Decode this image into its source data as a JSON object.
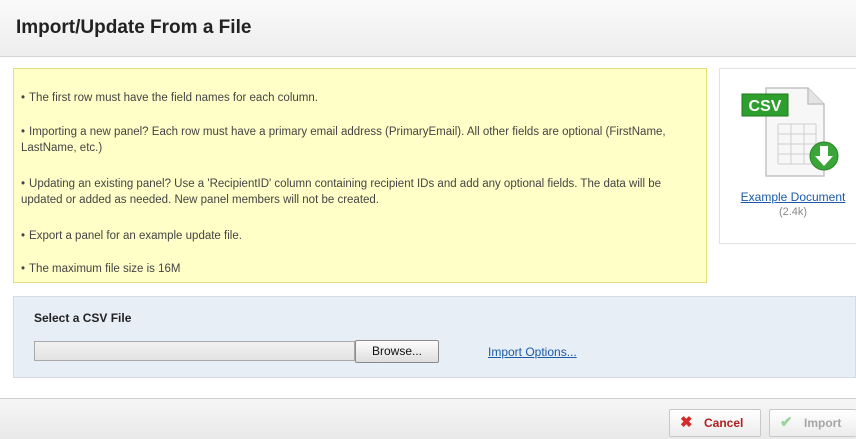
{
  "dialog": {
    "title": "Import/Update From a File"
  },
  "info": {
    "items": [
      "The first row must have the field names for each column.",
      "Importing a new panel? Each row must have a primary email address (PrimaryEmail). All other fields are optional (FirstName, LastName, etc.)",
      "Updating an existing panel? Use a 'RecipientID' column containing recipient IDs and add any optional fields. The data will be updated or added as needed. New panel members will not be created.",
      "Export a panel for an example update file.",
      "The maximum file size is 16M"
    ]
  },
  "example_doc": {
    "badge": "CSV",
    "link_label": "Example Document",
    "size": "(2.4k)",
    "icon": "csv-file-download-icon",
    "badge_color": "#2e9e2e"
  },
  "file_select": {
    "label": "Select a CSV File",
    "file_value": "",
    "browse_label": "Browse...",
    "import_options_label": "Import Options..."
  },
  "footer": {
    "cancel_label": "Cancel",
    "import_label": "Import",
    "cancel_icon": "x-icon",
    "import_icon": "checkmark-icon",
    "cancel_color": "#b01f1f",
    "import_color": "#a6a6a6"
  }
}
